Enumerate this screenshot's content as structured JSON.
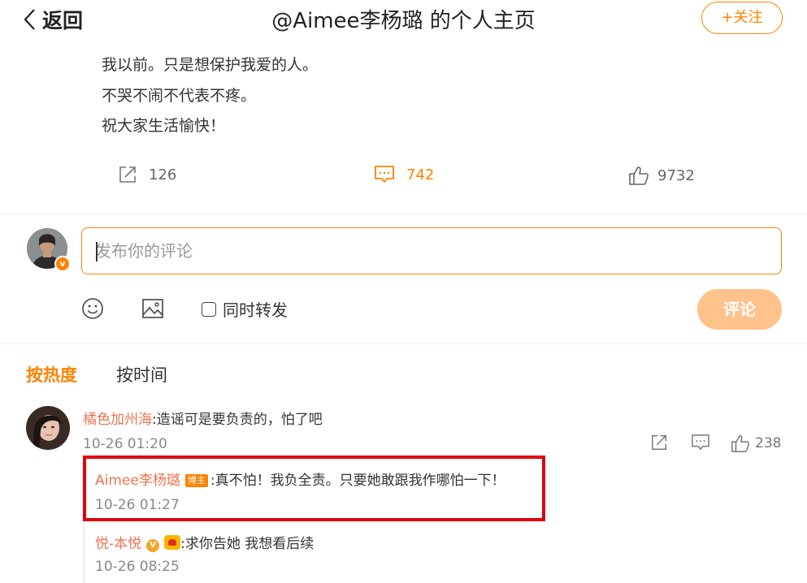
{
  "header": {
    "back_label": "返回",
    "title": "@Aimee李杨璐 的个人主页",
    "follow_label": "+关注"
  },
  "post": {
    "lines": [
      "我以前。只是想保护我爱的人。",
      "不哭不闹不代表不疼。",
      "祝大家生活愉快！"
    ],
    "actions": {
      "repost_count": "126",
      "comment_count": "742",
      "like_count": "9732"
    }
  },
  "composer": {
    "placeholder": "发布你的评论",
    "repost_option": "同时转发",
    "submit_label": "评论"
  },
  "sort_tabs": {
    "hot": "按热度",
    "time": "按时间"
  },
  "comments": [
    {
      "user": "橘色加州海",
      "text": ":造谣可是要负责的，怕了吧",
      "time": "10-26 01:20",
      "like_count": "238",
      "replies": [
        {
          "user": "Aimee李杨璐",
          "badge": "博主",
          "text": ":真不怕！我负全责。只要她敢跟我作哪怕一下！",
          "time": "10-26 01:27"
        },
        {
          "user": "悦-本悦",
          "badge": "V",
          "text": ":求你告她 我想看后续",
          "time": "10-26 08:25"
        }
      ]
    }
  ],
  "colors": {
    "accent": "#ff8200",
    "username": "#eb7350",
    "highlight_box": "#e00010",
    "submit_disabled": "#ffc28a"
  }
}
